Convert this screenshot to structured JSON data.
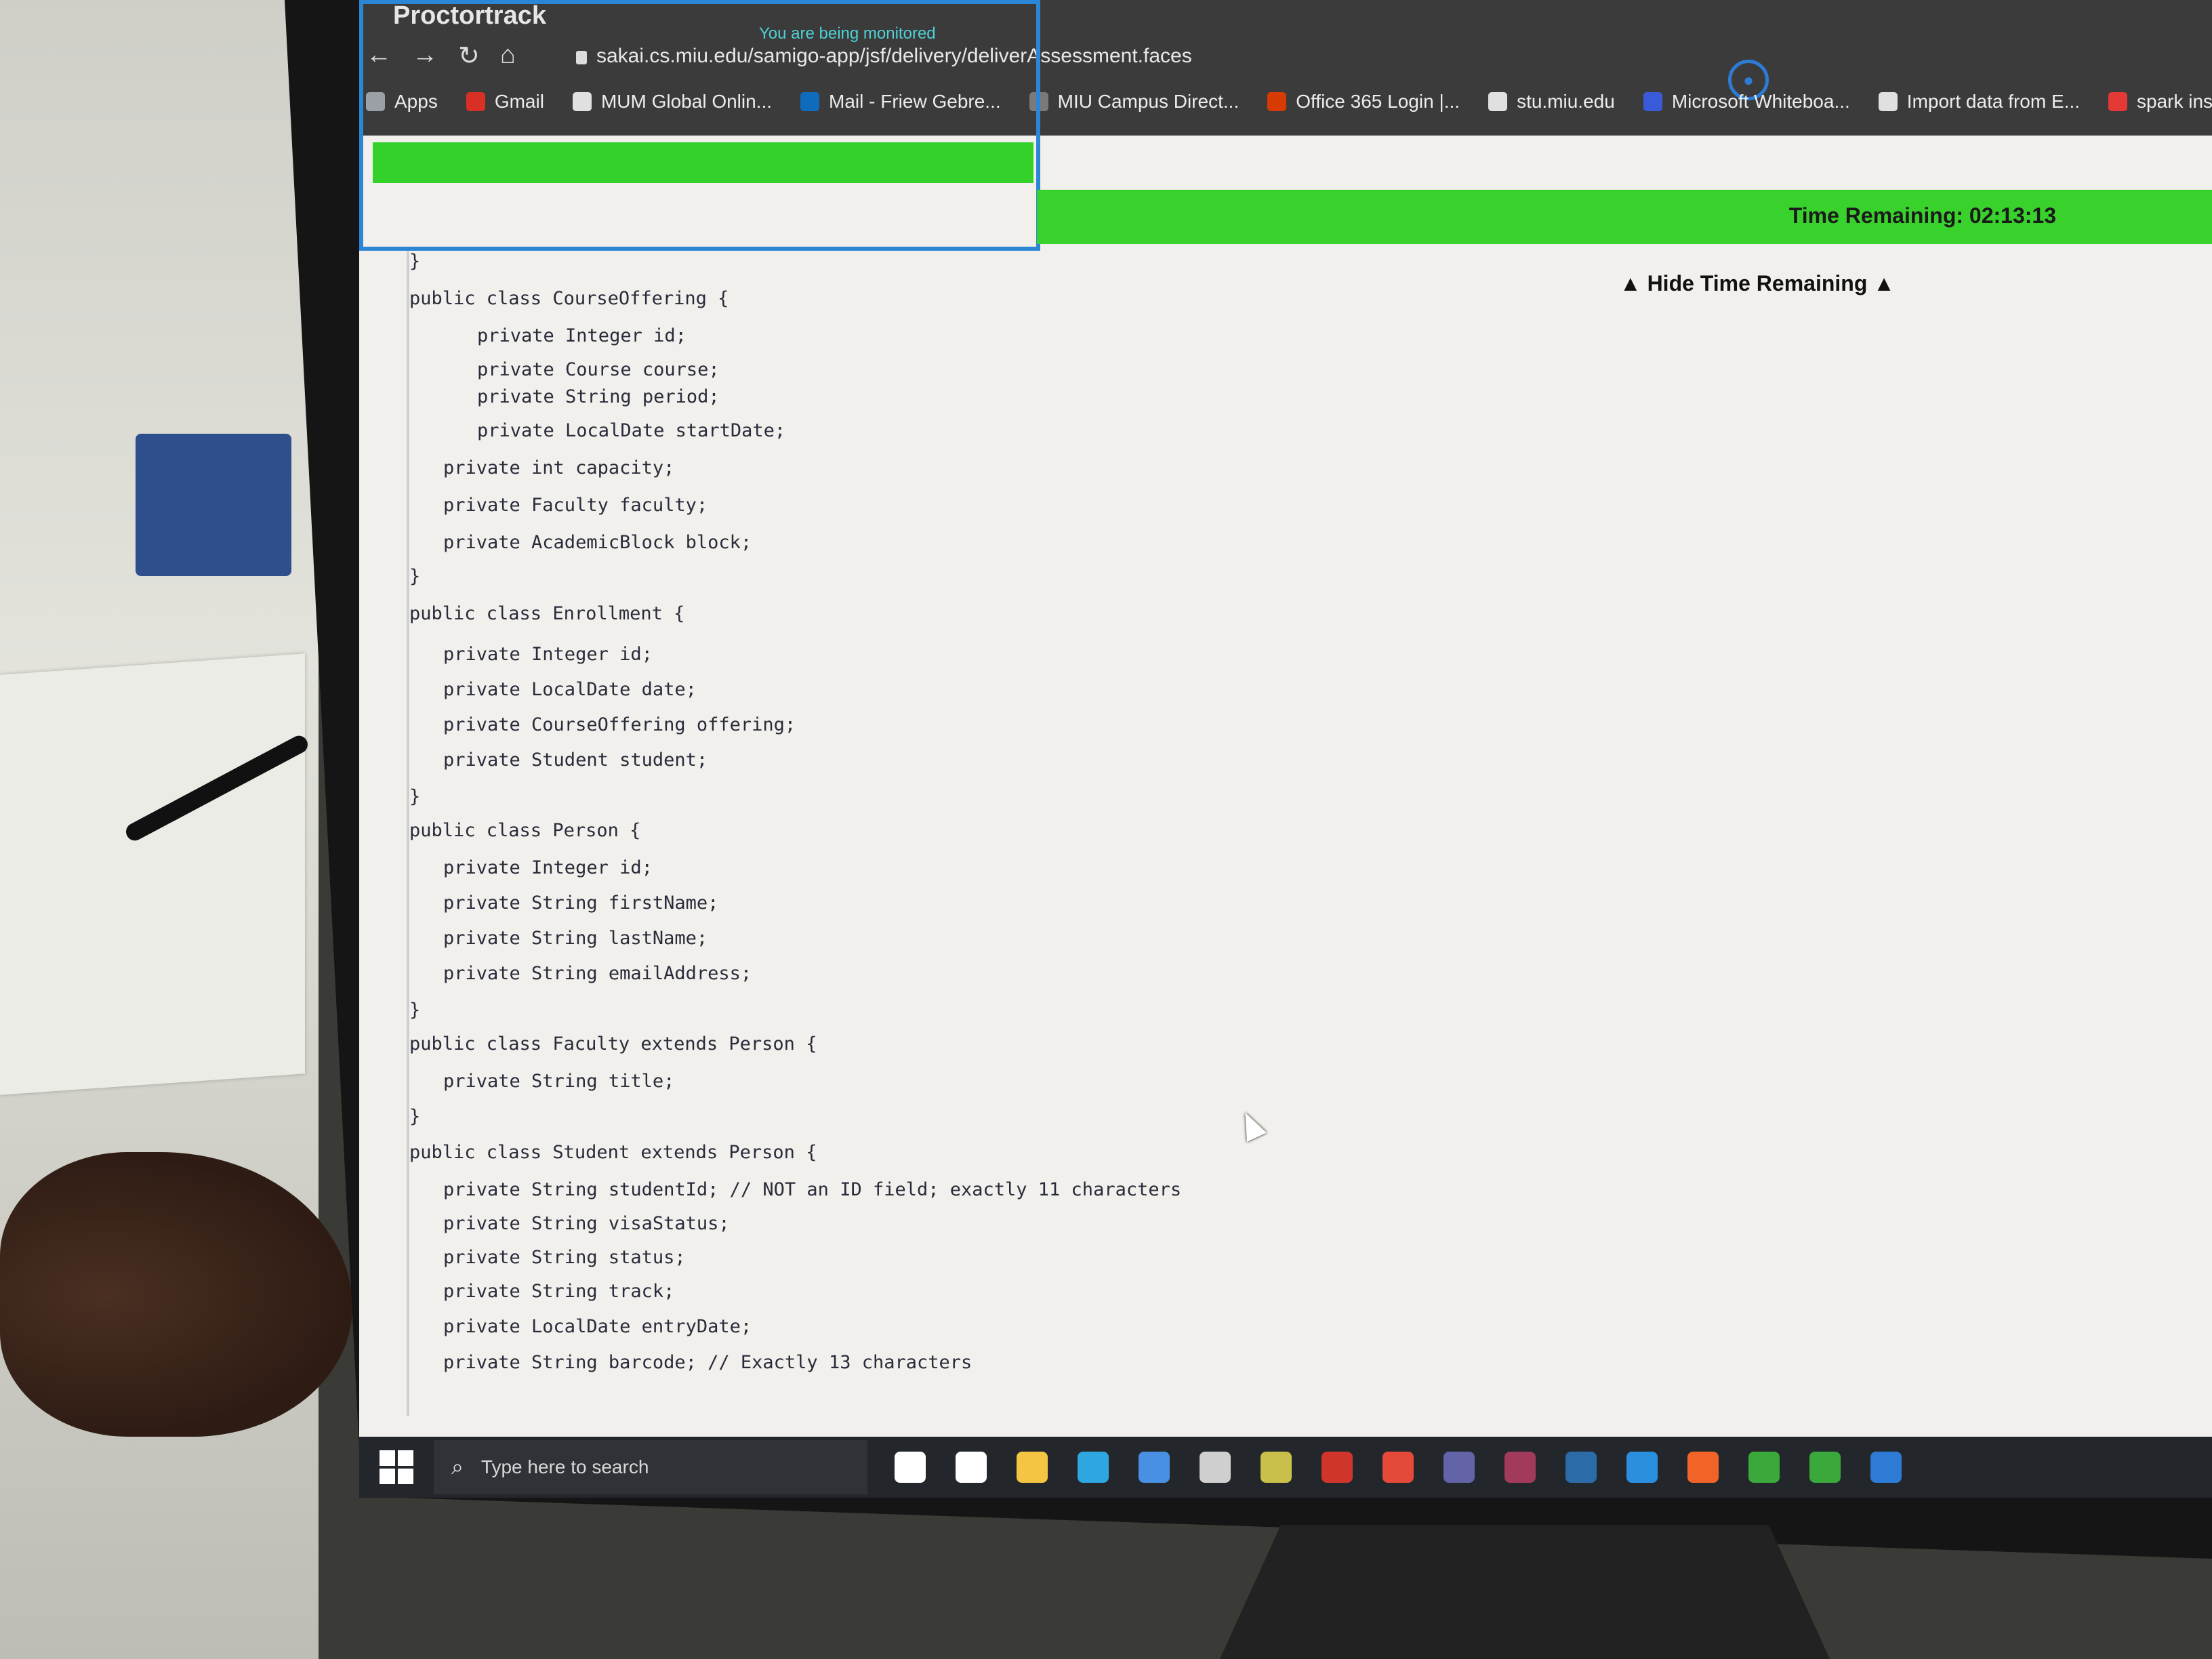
{
  "proctortrack": {
    "title": "Proctortrack",
    "monitored_text": "You are being monitored",
    "time_remaining": "Time Remaining: 02:13:13",
    "hide_time_label": "▲ Hide Time Remaining ▲"
  },
  "browser": {
    "url": "sakai.cs.miu.edu/samigo-app/jsf/delivery/deliverAssessment.faces",
    "bookmarks": [
      {
        "label": "Apps",
        "color": "#9aa0a6"
      },
      {
        "label": "Gmail",
        "color": "#d93025"
      },
      {
        "label": "MUM Global Onlin...",
        "color": "#e0e0e0"
      },
      {
        "label": "Mail - Friew Gebre...",
        "color": "#0f6cbd"
      },
      {
        "label": "MIU Campus Direct...",
        "color": "#7a7a7a"
      },
      {
        "label": "Office 365 Login |...",
        "color": "#d83b01"
      },
      {
        "label": "stu.miu.edu",
        "color": "#e0e0e0"
      },
      {
        "label": "Microsoft Whiteboa...",
        "color": "#3a5bd9"
      },
      {
        "label": "Import data from E...",
        "color": "#e0e0e0"
      },
      {
        "label": "spark installation",
        "color": "#e53935"
      }
    ]
  },
  "code": {
    "lines": [
      {
        "text": "}",
        "indent": 0
      },
      {
        "text": "public class CourseOffering {",
        "indent": 0
      },
      {
        "text": "private Integer id;",
        "indent": 2
      },
      {
        "text": "private Course course;",
        "indent": 2
      },
      {
        "text": "private String period;",
        "indent": 2
      },
      {
        "text": "private LocalDate startDate;",
        "indent": 2
      },
      {
        "text": "private int capacity;",
        "indent": 1
      },
      {
        "text": "private Faculty faculty;",
        "indent": 1
      },
      {
        "text": "private AcademicBlock block;",
        "indent": 1
      },
      {
        "text": "}",
        "indent": 0
      },
      {
        "text": "public class Enrollment {",
        "indent": 0
      },
      {
        "text": "private Integer id;",
        "indent": 1
      },
      {
        "text": "private LocalDate date;",
        "indent": 1
      },
      {
        "text": "private CourseOffering offering;",
        "indent": 1
      },
      {
        "text": "private Student student;",
        "indent": 1
      },
      {
        "text": "}",
        "indent": 0
      },
      {
        "text": "public class Person {",
        "indent": 0
      },
      {
        "text": "private Integer id;",
        "indent": 1
      },
      {
        "text": "private String firstName;",
        "indent": 1
      },
      {
        "text": "private String lastName;",
        "indent": 1
      },
      {
        "text": "private String emailAddress;",
        "indent": 1
      },
      {
        "text": "}",
        "indent": 0
      },
      {
        "text": "public class Faculty extends Person {",
        "indent": 0
      },
      {
        "text": "private String title;",
        "indent": 1
      },
      {
        "text": "}",
        "indent": 0
      },
      {
        "text": "public class Student extends Person {",
        "indent": 0
      },
      {
        "text": "private String studentId; // NOT an ID field; exactly 11 characters",
        "indent": 1
      },
      {
        "text": "private String visaStatus;",
        "indent": 1
      },
      {
        "text": "private String status;",
        "indent": 1
      },
      {
        "text": "private String track;",
        "indent": 1
      },
      {
        "text": "private LocalDate entryDate;",
        "indent": 1
      },
      {
        "text": "private String barcode; // Exactly 13 characters",
        "indent": 1
      }
    ]
  },
  "taskbar": {
    "search_placeholder": "Type here to search",
    "pinned": [
      {
        "name": "cortana-icon",
        "color": "#ffffff"
      },
      {
        "name": "task-view-icon",
        "color": "#ffffff"
      },
      {
        "name": "file-explorer-icon",
        "color": "#f4c542"
      },
      {
        "name": "edge-icon",
        "color": "#2ea7e0"
      },
      {
        "name": "mail-icon",
        "color": "#4a90e2"
      },
      {
        "name": "store-icon",
        "color": "#cfcfcf"
      },
      {
        "name": "app-icon",
        "color": "#c8c04a"
      },
      {
        "name": "app-icon",
        "color": "#d0352b"
      },
      {
        "name": "chrome-icon",
        "color": "#e5493a"
      },
      {
        "name": "teams-icon",
        "color": "#6264a7"
      },
      {
        "name": "app-icon",
        "color": "#a23a5a"
      },
      {
        "name": "app-icon",
        "color": "#2b6ca8"
      },
      {
        "name": "vscode-icon",
        "color": "#2b8fe0"
      },
      {
        "name": "app-icon",
        "color": "#f0642a"
      },
      {
        "name": "app-icon",
        "color": "#3aa83a"
      },
      {
        "name": "app-icon",
        "color": "#3aa83a"
      },
      {
        "name": "proctortrack-icon",
        "color": "#2e7bd6"
      }
    ]
  }
}
